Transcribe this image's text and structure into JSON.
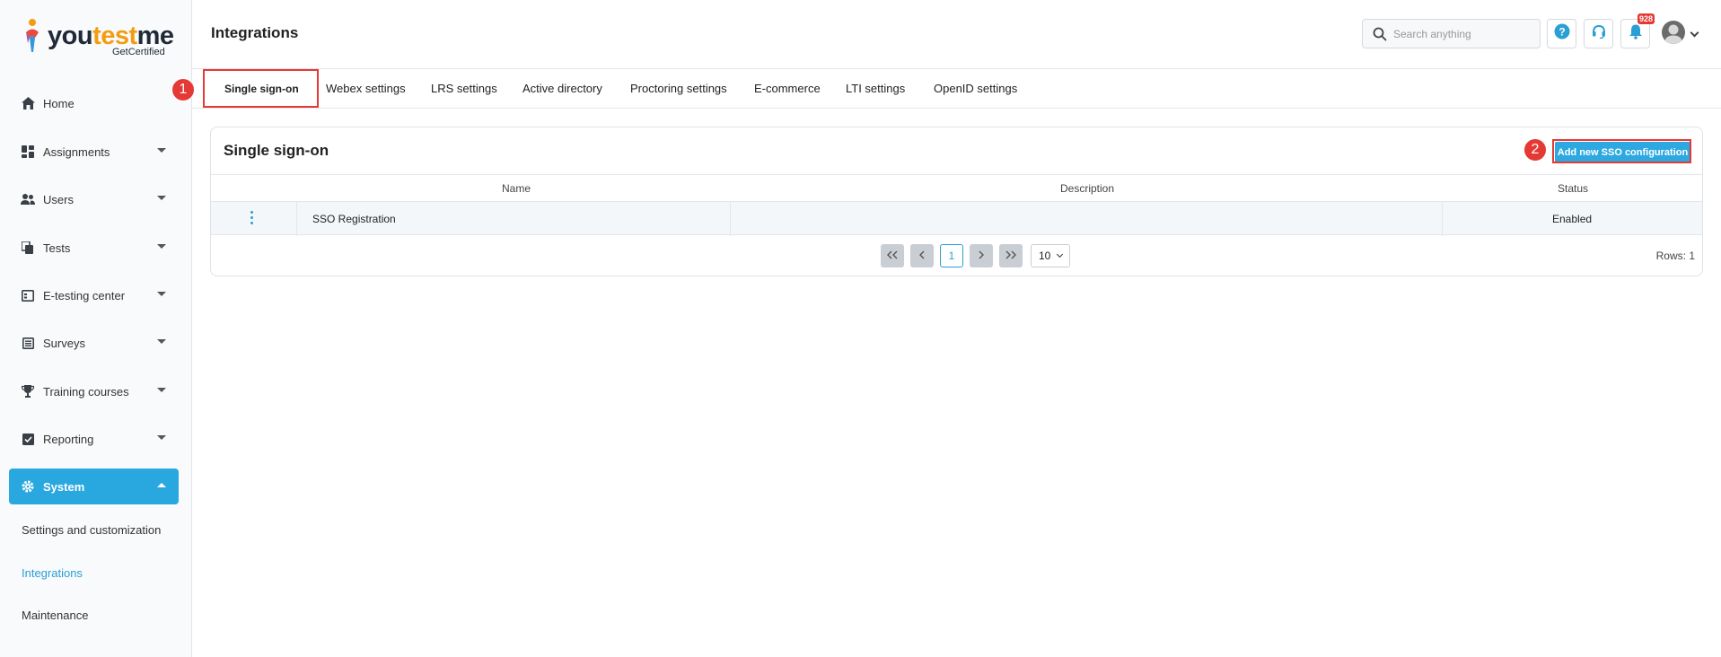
{
  "app": {
    "logo_word_start": "you",
    "logo_word_accent": "test",
    "logo_word_end": "me",
    "logo_sub": "GetCertified"
  },
  "sidebar": {
    "items": [
      {
        "label": "Home"
      },
      {
        "label": "Assignments"
      },
      {
        "label": "Users"
      },
      {
        "label": "Tests"
      },
      {
        "label": "E-testing center"
      },
      {
        "label": "Surveys"
      },
      {
        "label": "Training courses"
      },
      {
        "label": "Reporting"
      },
      {
        "label": "System"
      }
    ],
    "subitems": [
      {
        "label": "Settings and customization"
      },
      {
        "label": "Integrations"
      },
      {
        "label": "Maintenance"
      }
    ]
  },
  "header": {
    "title": "Integrations",
    "search_placeholder": "Search anything",
    "notification_count": "928"
  },
  "tabs": [
    {
      "label": "Single sign-on"
    },
    {
      "label": "Webex settings"
    },
    {
      "label": "LRS settings"
    },
    {
      "label": "Active directory"
    },
    {
      "label": "Proctoring settings"
    },
    {
      "label": "E-commerce"
    },
    {
      "label": "LTI settings"
    },
    {
      "label": "OpenID settings"
    }
  ],
  "annotations": {
    "step1": "1",
    "step2": "2"
  },
  "card": {
    "title": "Single sign-on",
    "add_button": "Add new SSO configuration",
    "columns": {
      "name": "Name",
      "description": "Description",
      "status": "Status"
    },
    "rows": [
      {
        "name": "SSO Registration",
        "description": "",
        "status": "Enabled"
      }
    ],
    "pager": {
      "current_page": "1",
      "page_size": "10",
      "rows_label": "Rows: 1"
    }
  },
  "colors": {
    "accent": "#29a8e0",
    "highlight": "#e53935"
  }
}
